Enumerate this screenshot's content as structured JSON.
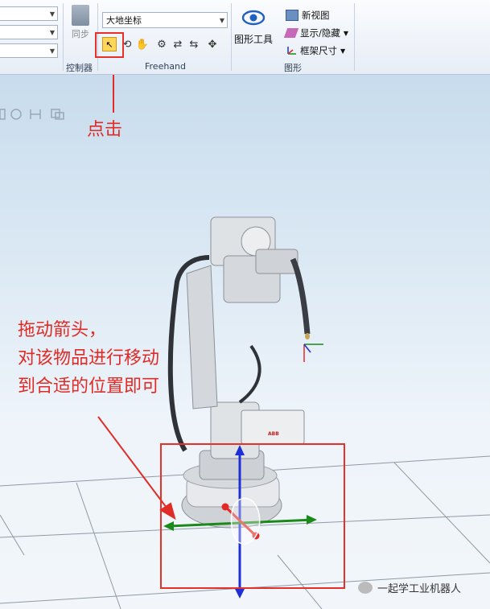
{
  "ribbon": {
    "coordinate_dropdown": "大地坐标",
    "sync_label": "同步",
    "groups": {
      "controller": "控制器",
      "freehand": "Freehand",
      "graphics": "图形"
    },
    "graphics_tools_label": "图形工具",
    "new_view_label": "新视图",
    "show_hide_label": "显示/隐藏",
    "frame_size_label": "框架尺寸"
  },
  "annotations": {
    "click": "点击",
    "drag_line1": "拖动箭头，",
    "drag_line2": "对该物品进行移动",
    "drag_line3": "到合适的位置即可"
  },
  "robot": {
    "brand": "ABB"
  },
  "watermark": {
    "text": "一起学工业机器人"
  },
  "colors": {
    "annotation_red": "#e02b26",
    "axis_x": "#1a8a1a",
    "axis_y": "#e02b26",
    "axis_z": "#1f2fd6"
  }
}
